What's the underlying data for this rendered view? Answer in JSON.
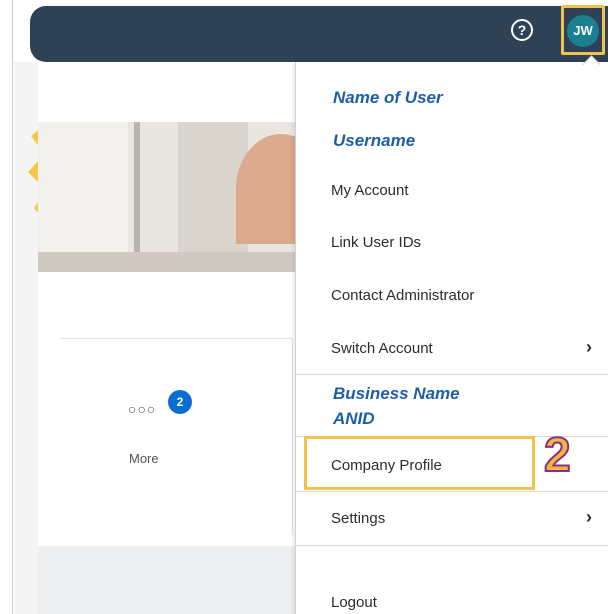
{
  "header": {
    "help_icon": "question-circle-icon",
    "avatar_initials": "JW"
  },
  "background": {
    "more": {
      "badge_count": "2",
      "label": "More",
      "icon": "more-dots-icon"
    }
  },
  "menu": {
    "user_name": "Name of User",
    "username": "Username",
    "items_top": [
      "My Account",
      "Link User IDs",
      "Contact Administrator",
      "Switch Account"
    ],
    "business_name": "Business Name",
    "anid": "ANID",
    "company_profile": "Company Profile",
    "settings": "Settings",
    "logout": "Logout",
    "chevron_icon": "chevron-right-icon"
  },
  "annotation": {
    "step_number": "2"
  },
  "colors": {
    "topbar": "#2f4154",
    "avatar": "#1a7f8e",
    "highlight": "#f2c14e",
    "header_text": "#1d5ea8",
    "badge": "#0a6ed1"
  }
}
